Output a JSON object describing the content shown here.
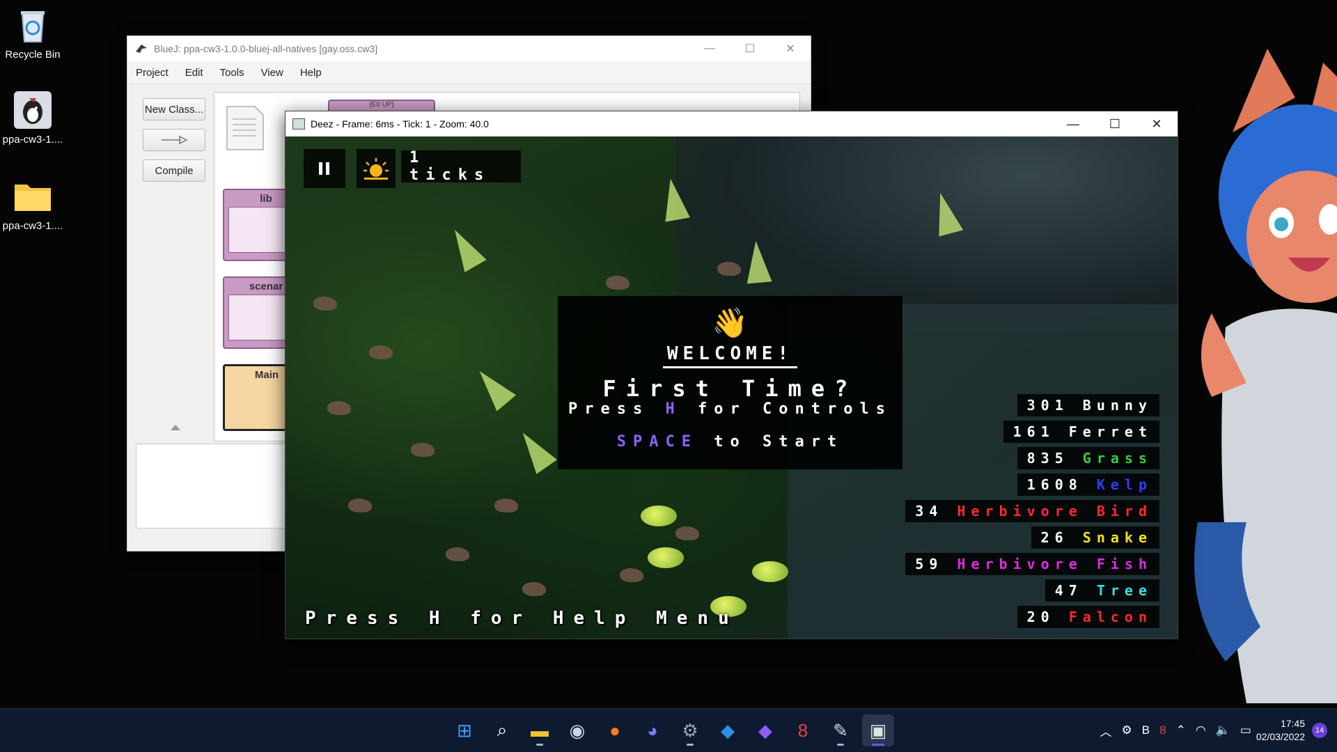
{
  "desktop": {
    "icons": [
      {
        "label": "Recycle Bin",
        "icon": "recycle-bin-icon"
      },
      {
        "label": "ppa-cw3-1....",
        "icon": "bluej-app-icon"
      },
      {
        "label": "ppa-cw3-1....",
        "icon": "folder-icon"
      }
    ]
  },
  "bluej": {
    "title": "BlueJ:  ppa-cw3-1.0.0-bluej-all-natives  [gay.oss.cw3]",
    "menu": [
      "Project",
      "Edit",
      "Tools",
      "View",
      "Help"
    ],
    "new_class": "New Class...",
    "compile": "Compile",
    "packages": [
      "lib",
      "scenar",
      "Main"
    ],
    "partial_label": "(E0 UP)"
  },
  "deez": {
    "title": "Deez - Frame: 6ms - Tick: 1 - Zoom: 40.0",
    "ticks": "1 ticks",
    "welcome": {
      "title": "WELCOME!",
      "first_time": "First Time?",
      "press_prefix": "Press ",
      "press_key": "H",
      "press_suffix": " for Controls",
      "space_key": "SPACE",
      "space_suffix": " to Start"
    },
    "help_hint": "Press H for Help Menu",
    "counts": [
      {
        "count": "301",
        "name": "Bunny",
        "color": "#ffffff"
      },
      {
        "count": "161",
        "name": "Ferret",
        "color": "#ffffff"
      },
      {
        "count": "835",
        "name": "Grass",
        "color": "#3ecb3e"
      },
      {
        "count": "1608",
        "name": "Kelp",
        "color": "#2f3cff"
      },
      {
        "count": "34",
        "name": "Herbivore Bird",
        "color": "#ff2a2a"
      },
      {
        "count": "26",
        "name": "Snake",
        "color": "#f3e51a"
      },
      {
        "count": "59",
        "name": "Herbivore Fish",
        "color": "#e02ae0"
      },
      {
        "count": "47",
        "name": "Tree",
        "color": "#35e0e0"
      },
      {
        "count": "20",
        "name": "Falcon",
        "color": "#ff2a2a"
      }
    ]
  },
  "taskbar": {
    "apps": [
      {
        "icon": "windows-start-icon",
        "glyph": "⊞",
        "color": "#3aa0ff"
      },
      {
        "icon": "search-icon",
        "glyph": "⌕",
        "color": "#ffffff"
      },
      {
        "icon": "file-explorer-icon",
        "glyph": "▬",
        "color": "#f2c230"
      },
      {
        "icon": "steam-icon",
        "glyph": "◉",
        "color": "#c9d6e6"
      },
      {
        "icon": "firefox-icon",
        "glyph": "●",
        "color": "#ff7b1c"
      },
      {
        "icon": "discord-icon",
        "glyph": "◕",
        "color": "#6c7fff"
      },
      {
        "icon": "settings-icon",
        "glyph": "⚙",
        "color": "#9aa4b4"
      },
      {
        "icon": "vscode-icon",
        "glyph": "◆",
        "color": "#2f8fe0"
      },
      {
        "icon": "obsidian-icon",
        "glyph": "◆",
        "color": "#8b5cf6"
      },
      {
        "icon": "git-client-icon",
        "glyph": "8",
        "color": "#e24242"
      },
      {
        "icon": "bluej-taskbar-icon",
        "glyph": "✎",
        "color": "#d5dbe6"
      },
      {
        "icon": "deez-taskbar-icon",
        "glyph": "▣",
        "color": "#d5e8dc"
      }
    ],
    "time": "17:45",
    "date": "02/03/2022",
    "notifications": "14"
  }
}
